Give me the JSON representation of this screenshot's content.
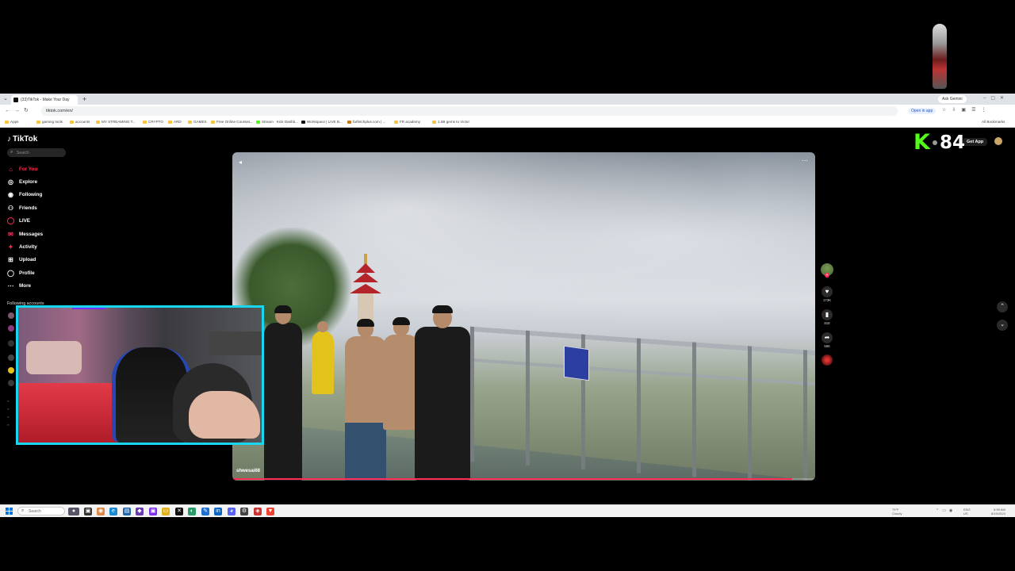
{
  "browser": {
    "tab_title": "(33)TikTok - Make Your Day",
    "tab_add": "+",
    "ask_gemini": "Ask Gemini",
    "url": "tiktok.com/en/",
    "open_in_app": "Open in app",
    "all_bookmarks": "All Bookmarks",
    "bookmarks": [
      {
        "label": "Apps"
      },
      {
        "label": "gaming tools"
      },
      {
        "label": "accounts"
      },
      {
        "label": "MY STREAMING T..."
      },
      {
        "label": "CRYPTO"
      },
      {
        "label": "ARD"
      },
      {
        "label": "GAMES"
      },
      {
        "label": "Free Online Courses..."
      },
      {
        "label": "Stream · Kick Dashb..."
      },
      {
        "label": "Workspace | LIVE B..."
      },
      {
        "label": "farfetchplus.com | ..."
      },
      {
        "label": "FR academy"
      },
      {
        "label": "1.5B gems to Victor"
      }
    ]
  },
  "tiktok": {
    "logo": "TikTok",
    "search_placeholder": "Search",
    "nav": [
      {
        "label": "For You",
        "icon": "home-icon"
      },
      {
        "label": "Explore",
        "icon": "compass-icon"
      },
      {
        "label": "Following",
        "icon": "following-icon"
      },
      {
        "label": "Friends",
        "icon": "friends-icon"
      },
      {
        "label": "LIVE",
        "icon": "live-icon"
      },
      {
        "label": "Messages",
        "icon": "messages-icon"
      },
      {
        "label": "Activity",
        "icon": "activity-icon"
      },
      {
        "label": "Upload",
        "icon": "upload-icon"
      },
      {
        "label": "Profile",
        "icon": "profile-icon"
      },
      {
        "label": "More",
        "icon": "more-icon"
      }
    ],
    "following_accounts": "Following accounts",
    "get_app": "Get App",
    "video": {
      "username": "shwesai68",
      "progress_fraction": 0.96
    },
    "actions": {
      "likes": "173K",
      "saves": "818",
      "shares": "566"
    }
  },
  "overlay": {
    "kick_logo": "K",
    "viewer_count": "84"
  },
  "taskbar": {
    "search_placeholder": "Search",
    "weather_temp": "79°F",
    "weather_desc": "Cloudy",
    "lang_1": "ENG",
    "lang_2": "US",
    "time": "6:59 AM",
    "date": "8/19/2024"
  },
  "colors": {
    "tiktok_accent": "#fe2c55",
    "kick_green": "#53fc18",
    "webcam_border": "#18d5f0",
    "webcam_bar": "#7b2ff0"
  }
}
